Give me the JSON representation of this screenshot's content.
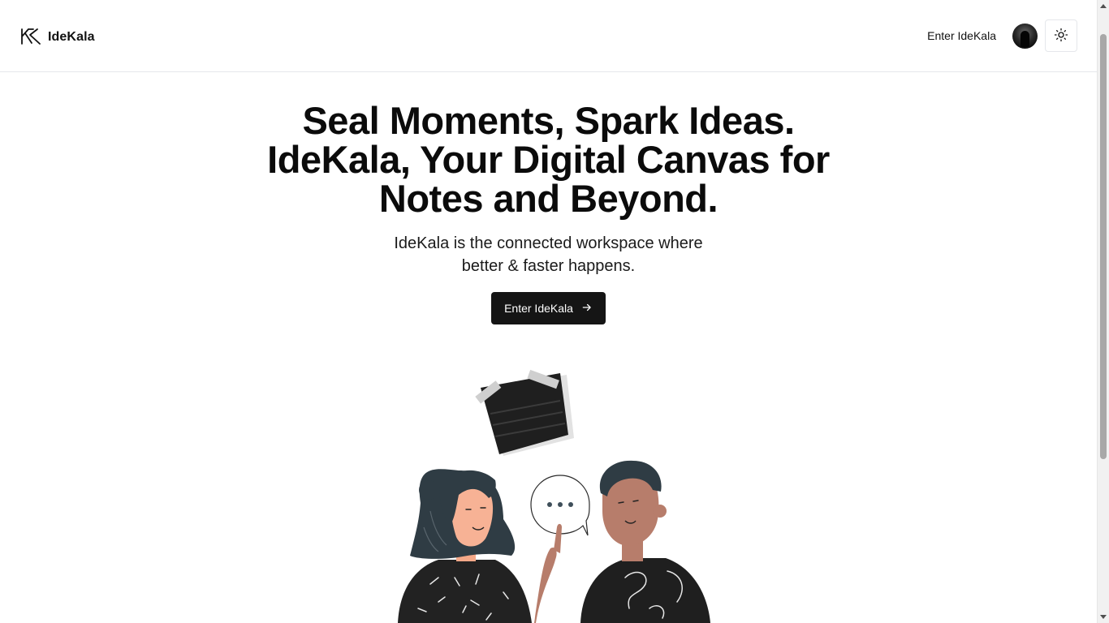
{
  "header": {
    "brand_name": "IdeKala",
    "logo_icon": "k-logo-icon",
    "nav_link": "Enter IdeKala",
    "avatar_icon": "user-avatar",
    "theme_toggle_icon": "sun-icon"
  },
  "hero": {
    "headline": "Seal Moments, Spark Ideas. IdeKala, Your Digital Canvas for Notes and Beyond.",
    "subtitle": "IdeKala is the connected workspace where better & faster happens.",
    "cta_label": "Enter IdeKala",
    "cta_icon": "arrow-right-icon"
  },
  "illustration": {
    "icon": "two-people-chatting-illustration",
    "speech_bubble_text": "..."
  },
  "colors": {
    "primary_button": "#151515",
    "text": "#0b0b0b",
    "border": "#e5e7eb"
  }
}
